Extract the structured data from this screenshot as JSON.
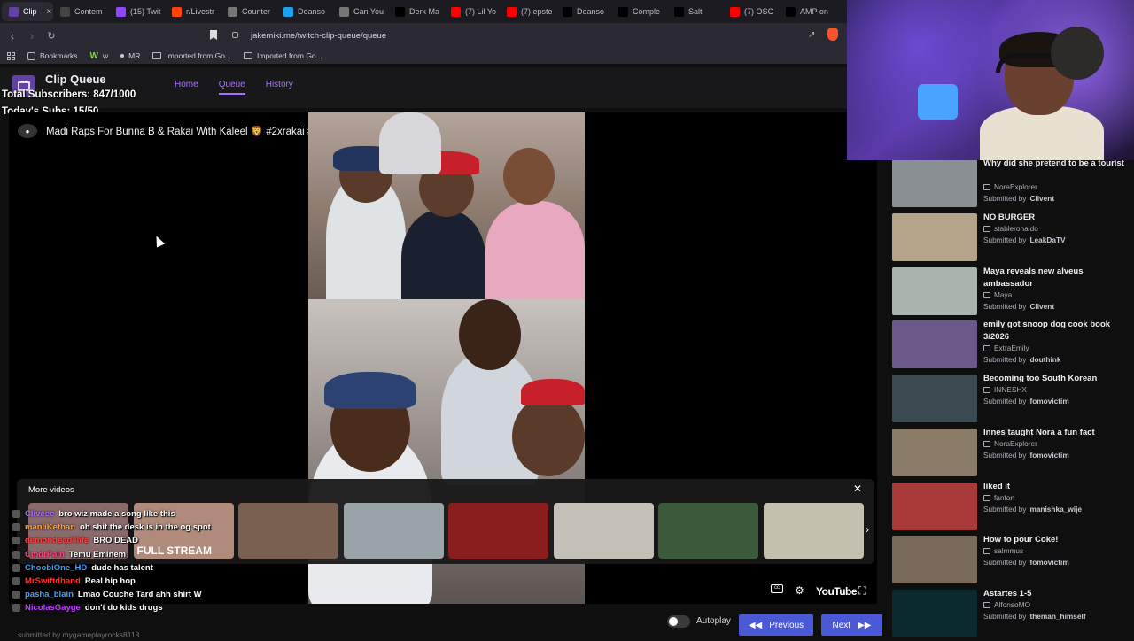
{
  "browser": {
    "tabs": [
      {
        "label": "Clip",
        "color": "#6441a5",
        "active": true
      },
      {
        "label": "Contem",
        "color": "#444"
      },
      {
        "label": "(15) Twit",
        "color": "#9146ff"
      },
      {
        "label": "r/Livestr",
        "color": "#ff4500"
      },
      {
        "label": "Counter",
        "color": "#777"
      },
      {
        "label": "Deanso",
        "color": "#1da1f2"
      },
      {
        "label": "Can You",
        "color": "#777"
      },
      {
        "label": "Derk Ma",
        "color": "#000"
      },
      {
        "label": "(7) Lil Yo",
        "color": "#ff0000"
      },
      {
        "label": "(7) epste",
        "color": "#ff0000"
      },
      {
        "label": "Deanso",
        "color": "#000"
      },
      {
        "label": "Comple",
        "color": "#000"
      },
      {
        "label": "Salt",
        "color": "#000"
      },
      {
        "label": "(7) OSC",
        "color": "#ff0000"
      },
      {
        "label": "AMP on",
        "color": "#000"
      }
    ],
    "url": "jakemiki.me/twitch-clip-queue/queue",
    "bookmarks": [
      {
        "label": "Bookmarks",
        "type": "star"
      },
      {
        "label": "w",
        "type": "w"
      },
      {
        "label": "MR",
        "type": "mr"
      },
      {
        "label": "Imported from Go...",
        "type": "folder"
      },
      {
        "label": "Imported from Go...",
        "type": "folder"
      }
    ]
  },
  "app": {
    "title": "Clip Queue",
    "nav": [
      "Home",
      "Queue",
      "History"
    ],
    "nav_current": "Queue"
  },
  "overlay": {
    "total_subs": "Total Subscribers: 847/1000",
    "today_subs": "Today's Subs: 15/50"
  },
  "clip": {
    "title": "Madi Raps For Bunna B & Rakai With Kaleel 🦁 #2xrakai #madi #kaleel #reemknocks #bunnab #cloverboys",
    "submitted_by": "submitted by mygameplayrocks8118"
  },
  "more_videos": {
    "title": "More videos",
    "thumbs": [
      {
        "caption": "",
        "bg": "#8a6a6a"
      },
      {
        "caption": "FULL STREAM",
        "bg": "#b08a7a"
      },
      {
        "caption": "",
        "bg": "#7a6050"
      },
      {
        "caption": "",
        "bg": "#9aa3a8"
      },
      {
        "caption": "",
        "bg": "#8a1e1e"
      },
      {
        "caption": "",
        "bg": "#c4c0b8"
      },
      {
        "caption": "",
        "bg": "#3a5a3a"
      },
      {
        "caption": "",
        "bg": "#c4c0b0"
      }
    ]
  },
  "chat": [
    {
      "name": "Cliveee",
      "msg": "bro wiz made a song like this",
      "color": "#a970ff"
    },
    {
      "name": "manliKethan",
      "msg": "oh shit the desk is in the og spot",
      "color": "#ff9d3d"
    },
    {
      "name": "demondead4life",
      "msg": "BRO DEAD",
      "color": "#ff4040"
    },
    {
      "name": "CmdrPain",
      "msg": "Temu Eminem",
      "color": "#ff4080"
    },
    {
      "name": "ChoobiOne_HD",
      "msg": "dude has talent",
      "color": "#40a0ff"
    },
    {
      "name": "MrSwiftdhand",
      "msg": "Real hip hop",
      "color": "#ff3030"
    },
    {
      "name": "pasha_blain",
      "msg": "Lmao Couche Tard ahh shirt W",
      "color": "#40a0ff"
    },
    {
      "name": "NicolasGayge",
      "msg": "don't do kids drugs",
      "color": "#c040ff"
    }
  ],
  "player": {
    "brand": "YouTube",
    "play_label": "Play (k)"
  },
  "footer": {
    "autoplay": "Autoplay",
    "previous": "Previous",
    "next": "Next"
  },
  "queue": [
    {
      "title": "Why did she pretend to be a tourist",
      "channel": "NoraExplorer",
      "submitter": "Clivent",
      "bg": "#8a8f94"
    },
    {
      "title": "NO BURGER",
      "channel": "stableronaldo",
      "submitter": "LeakDaTV",
      "bg": "#b6a48a"
    },
    {
      "title": "Maya reveals new alveus ambassador",
      "channel": "Maya",
      "submitter": "Clivent",
      "bg": "#a9b2ad"
    },
    {
      "title": "emily got snoop dog cook book 3/2026",
      "channel": "ExtraEmily",
      "submitter": "douthink",
      "bg": "#6a5a8a"
    },
    {
      "title": "Becoming too South Korean",
      "channel": "INNESHX",
      "submitter": "fomovictim",
      "bg": "#3a4a50"
    },
    {
      "title": "Innes taught Nora a fun fact",
      "channel": "NoraExplorer",
      "submitter": "fomovictim",
      "bg": "#8a7a68"
    },
    {
      "title": "liked it",
      "channel": "fanfan",
      "submitter": "manishka_wije",
      "bg": "#a83a3a"
    },
    {
      "title": "How to pour Coke!",
      "channel": "salmmus",
      "submitter": "fomovictim",
      "bg": "#7a6a5a"
    },
    {
      "title": "Astartes 1-5",
      "channel": "AlfonsoMO",
      "submitter": "theman_himself",
      "bg": "#0a2a2e"
    }
  ],
  "submitted_prefix": "Submitted by"
}
